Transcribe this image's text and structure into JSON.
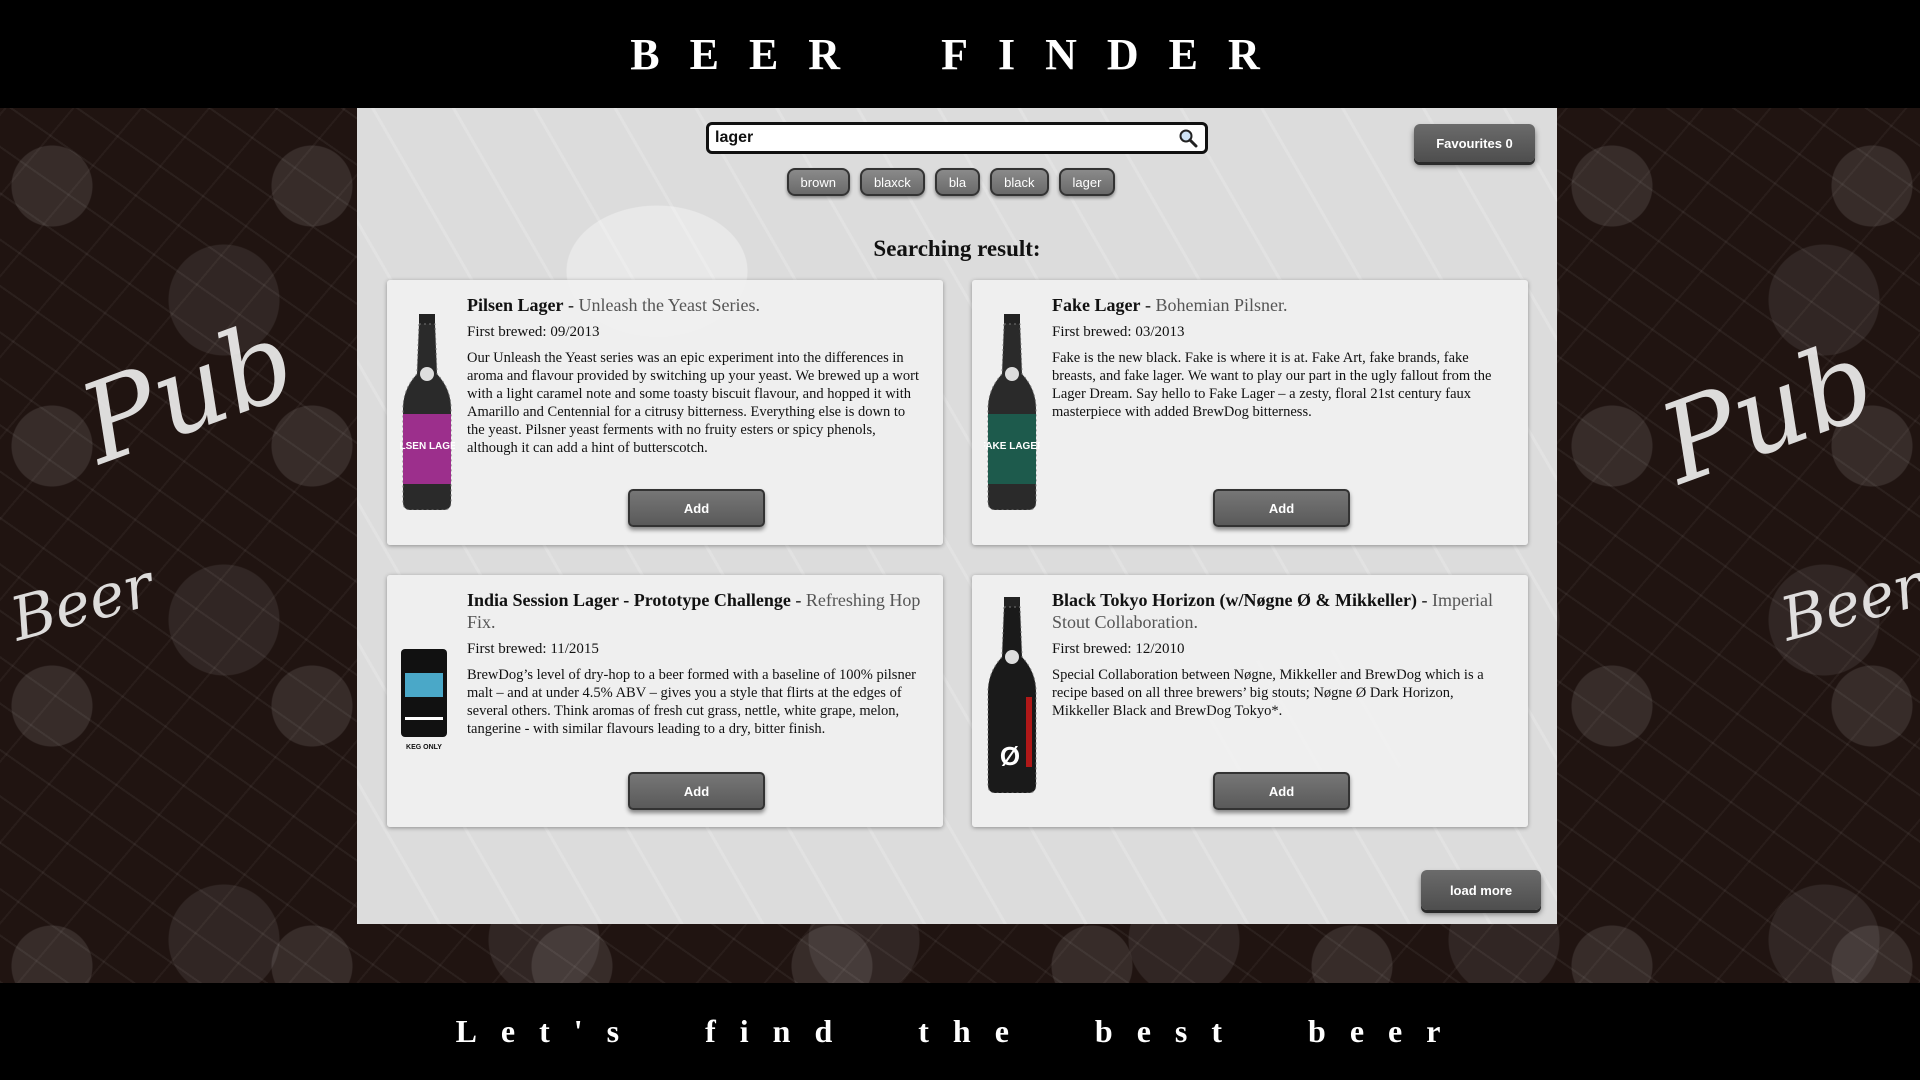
{
  "header": {
    "title": "BEER FINDER"
  },
  "footer": {
    "tagline": "Let's find the best beer"
  },
  "background": {
    "doodle_text": "Pub",
    "doodle_text_2": "Beer"
  },
  "search": {
    "value": "lager"
  },
  "favourites_label": "Favourites 0",
  "recent_searches": [
    "brown",
    "blaxck",
    "bla",
    "black",
    "lager"
  ],
  "results_heading": "Searching result:",
  "beers": [
    {
      "name": "Pilsen Lager",
      "tagline": "Unleash the Yeast Series.",
      "first_brewed": "First brewed: 09/2013",
      "description": "Our Unleash the Yeast series was an epic experiment into the differences in aroma and flavour provided by switching up your yeast. We brewed up a wort with a light caramel note and some toasty biscuit flavour, and hopped it with Amarillo and Centennial for a citrusy bitterness. Everything else is down to the yeast. Pilsner yeast ferments with no fruity esters or spicy phenols, although it can add a hint of butterscotch.",
      "label_text": "PILSEN LAGER",
      "label_color": "#9c2f8c",
      "add_label": "Add"
    },
    {
      "name": "Fake Lager",
      "tagline": "Bohemian Pilsner.",
      "first_brewed": "First brewed: 03/2013",
      "description": "Fake is the new black. Fake is where it is at. Fake Art, fake brands, fake breasts, and fake lager. We want to play our part in the ugly fallout from the Lager Dream. Say hello to Fake Lager – a zesty, floral 21st century faux masterpiece with added BrewDog bitterness.",
      "label_text": "FAKE LAGER",
      "label_color": "#1d5a4c",
      "add_label": "Add"
    },
    {
      "name": "India Session Lager - Prototype Challenge",
      "tagline": "Refreshing Hop Fix.",
      "first_brewed": "First brewed: 11/2015",
      "description": "BrewDog’s level of dry-hop to a beer formed with a baseline of 100% pilsner malt – and at under 4.5% ABV – gives you a style that flirts at the edges of several others. Think aromas of fresh cut grass, nettle, white grape, melon, tangerine - with similar flavours leading to a dry, bitter finish.",
      "label_text": "KEG ONLY",
      "label_color": "#4aa8c8",
      "add_label": "Add"
    },
    {
      "name": "Black Tokyo Horizon (w/Nøgne Ø & Mikkeller)",
      "tagline": "Imperial Stout Collaboration.",
      "first_brewed": "First brewed: 12/2010",
      "description": "Special Collaboration between Nøgne, Mikkeller and BrewDog which is a recipe based on all three brewers’ big stouts; Nøgne Ø Dark Horizon, Mikkeller Black and BrewDog Tokyo*.",
      "label_text": "Ø",
      "label_color": "#b01818",
      "add_label": "Add"
    }
  ],
  "load_more_label": "load more"
}
